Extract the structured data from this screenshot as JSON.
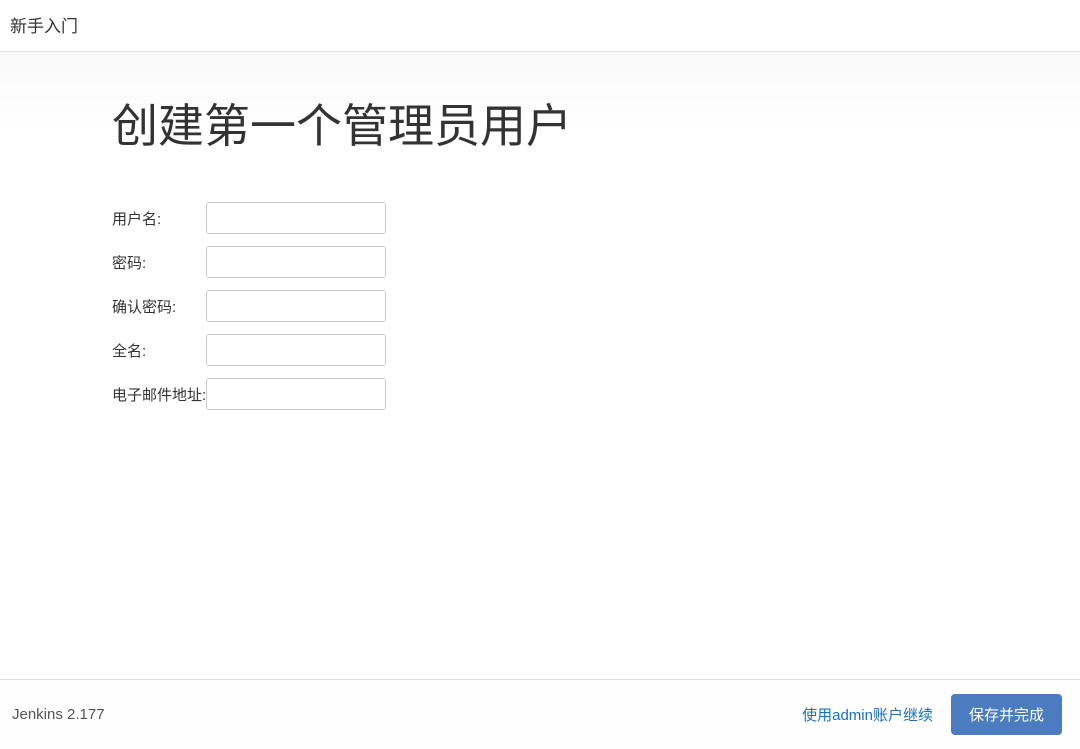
{
  "header": {
    "title": "新手入门"
  },
  "main": {
    "title": "创建第一个管理员用户",
    "fields": {
      "username": {
        "label": "用户名:",
        "value": ""
      },
      "password": {
        "label": "密码:",
        "value": ""
      },
      "confirmPassword": {
        "label": "确认密码:",
        "value": ""
      },
      "fullname": {
        "label": "全名:",
        "value": ""
      },
      "email": {
        "label": "电子邮件地址:",
        "value": ""
      }
    }
  },
  "footer": {
    "version": "Jenkins 2.177",
    "continueAsAdmin": "使用admin账户继续",
    "saveAndFinish": "保存并完成"
  }
}
